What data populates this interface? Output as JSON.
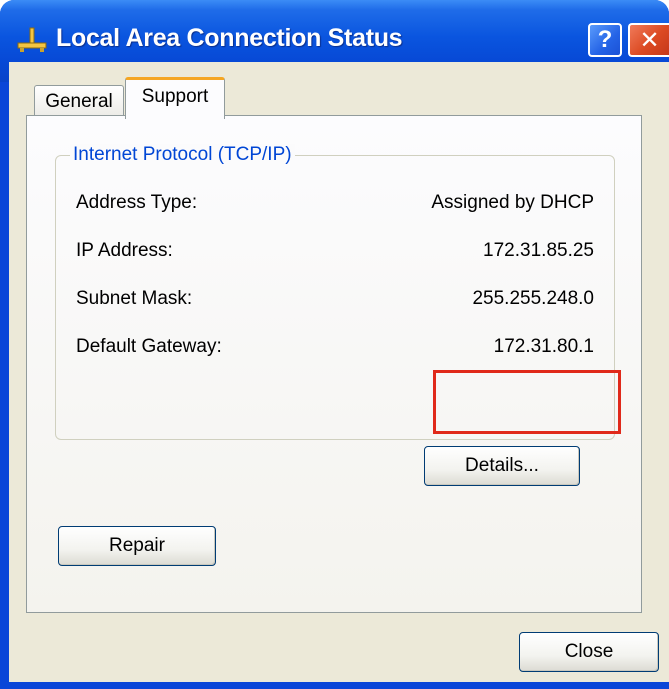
{
  "window": {
    "title": "Local Area Connection Status",
    "help_glyph": "?",
    "close_glyph": "✕",
    "title_icon": "network-connection-icon"
  },
  "tabs": [
    {
      "label": "General",
      "active": false
    },
    {
      "label": "Support",
      "active": true
    }
  ],
  "group": {
    "title": "Internet Protocol (TCP/IP)",
    "rows": [
      {
        "label": "Address Type:",
        "value": "Assigned by DHCP"
      },
      {
        "label": "IP Address:",
        "value": "172.31.85.25"
      },
      {
        "label": "Subnet Mask:",
        "value": "255.255.248.0"
      },
      {
        "label": "Default Gateway:",
        "value": "172.31.80.1"
      }
    ]
  },
  "buttons": {
    "details": "Details...",
    "repair": "Repair",
    "close": "Close"
  },
  "colors": {
    "titlebar": "#0a55df",
    "group_title": "#0046d5",
    "highlight": "#e0291a",
    "active_tab_accent": "#f5a623"
  }
}
